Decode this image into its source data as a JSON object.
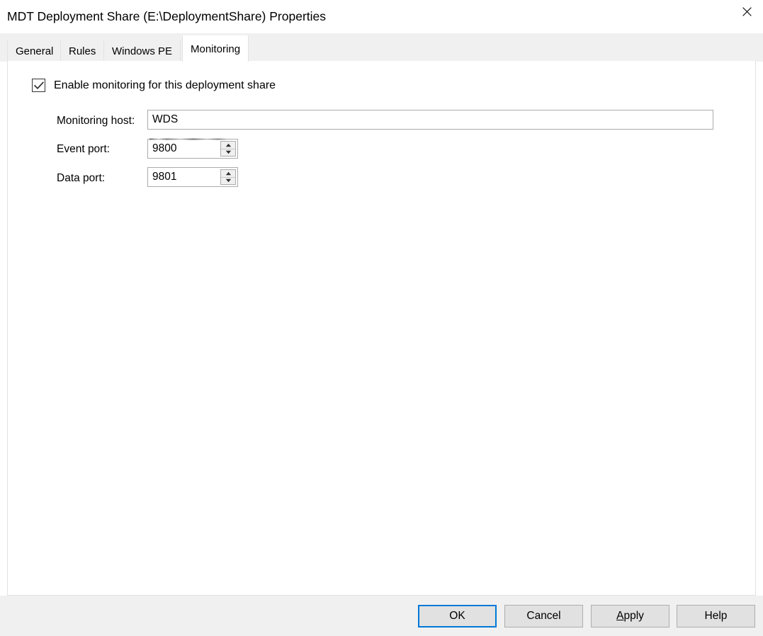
{
  "window": {
    "title": "MDT Deployment Share (E:\\DeploymentShare) Properties",
    "close_icon": "close-icon"
  },
  "tabs": [
    {
      "id": "general",
      "label": "General",
      "selected": false
    },
    {
      "id": "rules",
      "label": "Rules",
      "selected": false
    },
    {
      "id": "windows-pe",
      "label": "Windows PE",
      "selected": false
    },
    {
      "id": "monitoring",
      "label": "Monitoring",
      "selected": true
    }
  ],
  "monitoring": {
    "enable_checkbox": {
      "label": "Enable monitoring for this deployment share",
      "checked": true,
      "icon": "checkmark-icon"
    },
    "fields": [
      {
        "id": "monitoring-host",
        "label": "Monitoring host:",
        "value": "WDS",
        "spinner": false
      },
      {
        "id": "event-port",
        "label": "Event port:",
        "value": "9800",
        "spinner": true
      },
      {
        "id": "data-port",
        "label": "Data port:",
        "value": "9801",
        "spinner": true
      }
    ],
    "spinner_icons": {
      "up": "triangle-up-icon",
      "down": "triangle-down-icon"
    }
  },
  "footer": {
    "buttons": [
      {
        "id": "ok",
        "label": "OK",
        "default": true
      },
      {
        "id": "cancel",
        "label": "Cancel",
        "default": false
      },
      {
        "id": "apply",
        "label": "Apply",
        "accelerator": "A",
        "default": false
      },
      {
        "id": "help",
        "label": "Help",
        "default": false
      }
    ]
  },
  "colors": {
    "accent": "#0078d7",
    "dialog_background": "#ffffff",
    "chrome_background": "#f0f0f0",
    "button_face": "#e1e1e1",
    "border": "#ababab"
  }
}
